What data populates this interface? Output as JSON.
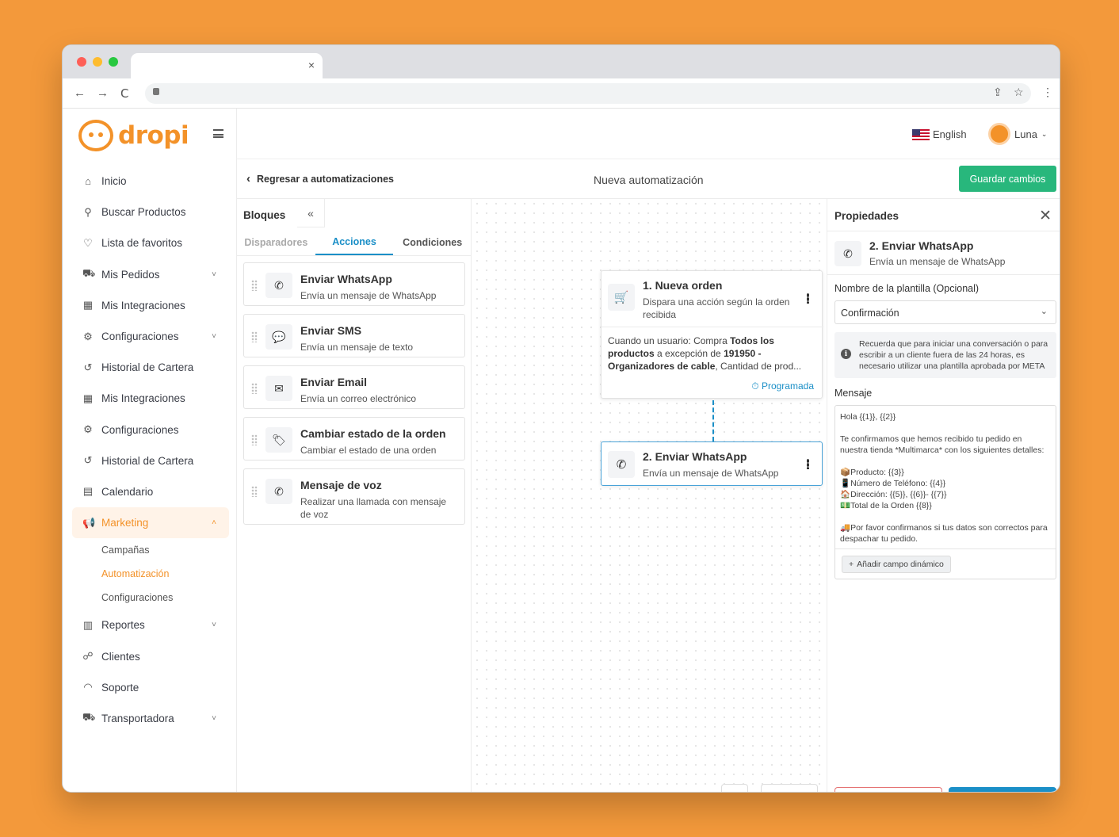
{
  "browser": {
    "tab_close": "×",
    "nav_back": "←",
    "nav_forward": "→",
    "nav_reload": "C",
    "share": "⇪",
    "star": "☆",
    "more": "⋮"
  },
  "brand": {
    "name": "dropi",
    "color": "#f39229"
  },
  "topbar": {
    "language": "English",
    "user": "Luna"
  },
  "sidebar": {
    "items": [
      {
        "label": "Inicio",
        "icon": "home-icon"
      },
      {
        "label": "Buscar Productos",
        "icon": "search-icon"
      },
      {
        "label": "Lista de favoritos",
        "icon": "heart-icon"
      },
      {
        "label": "Mis Pedidos",
        "icon": "cart-icon",
        "chevron": true
      },
      {
        "label": "Mis Integraciones",
        "icon": "store-icon"
      },
      {
        "label": "Configuraciones",
        "icon": "gear-icon",
        "chevron": true
      },
      {
        "label": "Historial de Cartera",
        "icon": "history-icon"
      },
      {
        "label": "Mis Integraciones",
        "icon": "store-icon"
      },
      {
        "label": "Configuraciones",
        "icon": "gear-icon"
      },
      {
        "label": "Historial de Cartera",
        "icon": "history-icon"
      },
      {
        "label": "Calendario",
        "icon": "calendar-icon"
      },
      {
        "label": "Marketing",
        "icon": "megaphone-icon",
        "active": true
      },
      {
        "label": "Reportes",
        "icon": "chart-icon",
        "chevron": true
      },
      {
        "label": "Clientes",
        "icon": "clients-icon"
      },
      {
        "label": "Soporte",
        "icon": "headset-icon"
      },
      {
        "label": "Transportadora",
        "icon": "truck-icon",
        "chevron": true
      }
    ],
    "marketing_sub": [
      "Campañas",
      "Automatización",
      "Configuraciones"
    ]
  },
  "header": {
    "back": "Regresar a automatizaciones",
    "title": "Nueva automatización",
    "save": "Guardar cambios"
  },
  "blocks": {
    "title": "Bloques",
    "tabs": [
      "Disparadores",
      "Acciones",
      "Condiciones"
    ],
    "cards": [
      {
        "title": "Enviar WhatsApp",
        "desc": "Envía un mensaje de WhatsApp",
        "icon": "whatsapp-icon"
      },
      {
        "title": "Enviar SMS",
        "desc": "Envía un mensaje de texto",
        "icon": "sms-icon"
      },
      {
        "title": "Enviar Email",
        "desc": "Envía un correo electrónico",
        "icon": "email-icon"
      },
      {
        "title": "Cambiar estado de la orden",
        "desc": "Cambiar el estado de una orden",
        "icon": "tag-icon"
      },
      {
        "title": "Mensaje de voz",
        "desc": "Realizar una llamada con mensaje de voz",
        "icon": "phone-icon"
      }
    ]
  },
  "flow": {
    "node1": {
      "title": "1. Nueva orden",
      "desc": "Dispara una acción según la orden recibida",
      "body_prefix": "Cuando un usuario: Compra ",
      "body_bold1": "Todos los productos",
      "body_mid": " a excepción de ",
      "body_bold2": "191950 - Organizadores de cable",
      "body_suffix": ", Cantidad de prod...",
      "badge": "Programada"
    },
    "node2": {
      "title": "2. Enviar WhatsApp",
      "desc": "Envía un mensaje de WhatsApp"
    }
  },
  "properties": {
    "title": "Propiedades",
    "selected_title": "2. Enviar WhatsApp",
    "selected_desc": "Envía un mensaje de WhatsApp",
    "template_label": "Nombre de la plantilla (Opcional)",
    "template_value": "Confirmación",
    "info": "Recuerda que para iniciar una conversación o para escribir a un cliente fuera de las 24 horas, es necesario utilizar una plantilla aprobada por META",
    "message_label": "Mensaje",
    "message": "Hola {{1}}, {{2}}\n\nTe confirmamos que hemos recibido tu pedido en nuestra tienda *Multimarca* con los siguientes detalles:\n\n📦Producto: {{3}}\n📱Número de Teléfono: {{4}}\n🏠Dirección: {{5}}, {{6}}- {{7}}\n💵Total de la Orden {{8}}\n\n🚚Por favor confirmanos si tus datos son correctos para despachar tu pedido.",
    "add_field": "Añadir campo dinámico"
  },
  "colors": {
    "accent_green": "#28b77c",
    "accent_blue": "#1b8fc7",
    "background": "#f3993b"
  }
}
